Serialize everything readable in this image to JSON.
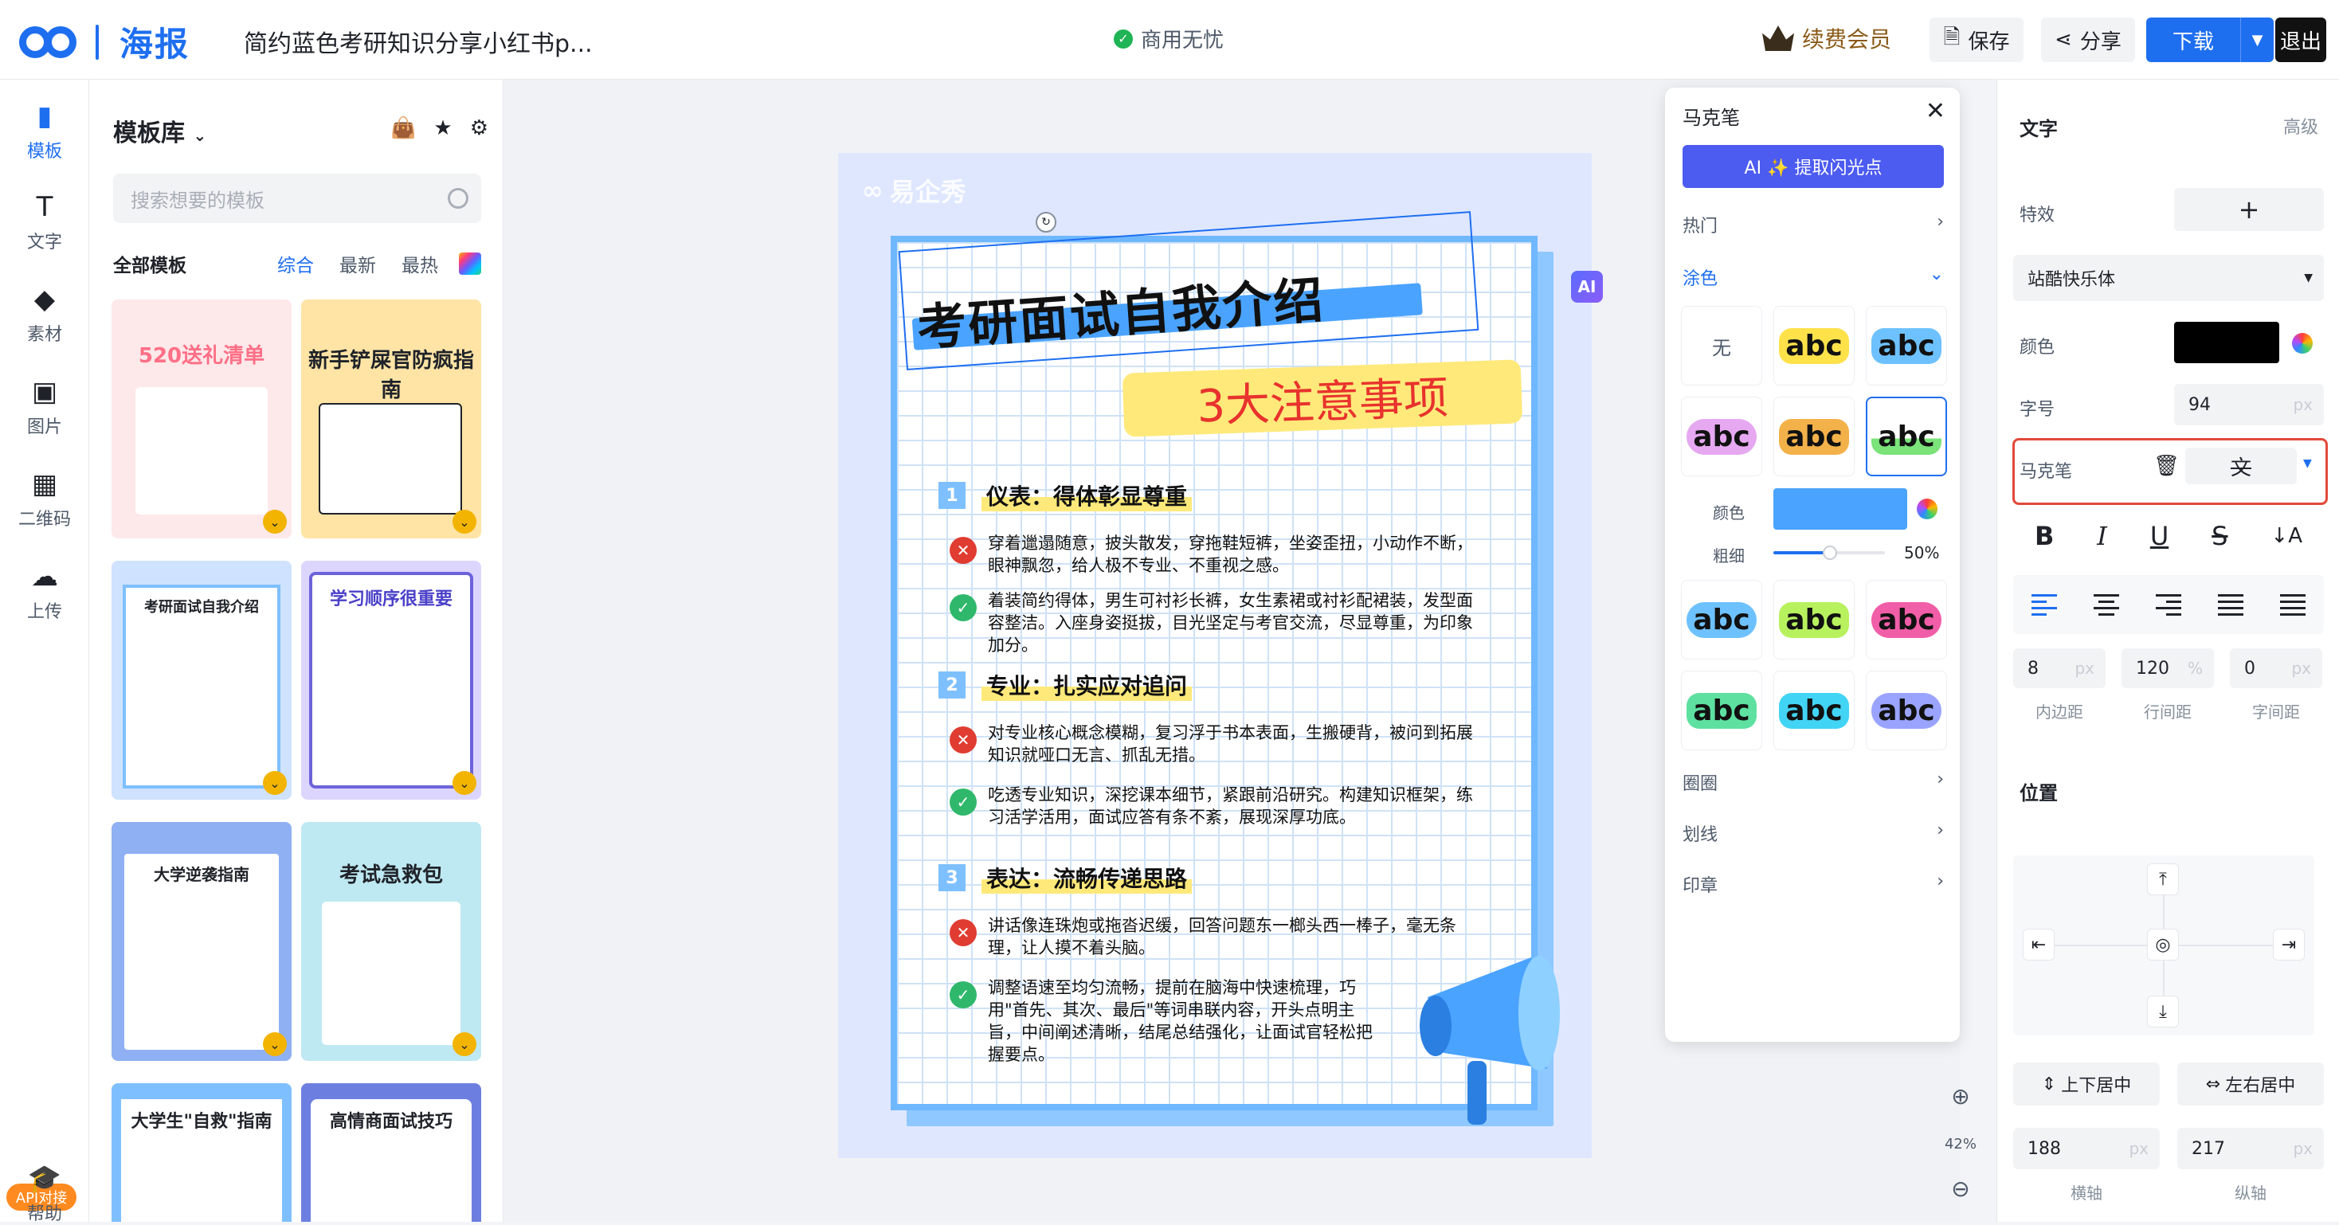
{
  "app": {
    "brand": "海报",
    "doc_title": "简约蓝色考研知识分享小红书p...",
    "commercial": "商用无忧",
    "vip": "续费会员",
    "save": "保存",
    "share": "分享",
    "download": "下载",
    "exit": "退出"
  },
  "leftbar": {
    "items": [
      {
        "label": "模板",
        "icon": "template-icon"
      },
      {
        "label": "文字",
        "icon": "text-icon"
      },
      {
        "label": "素材",
        "icon": "elements-icon"
      },
      {
        "label": "图片",
        "icon": "image-icon"
      },
      {
        "label": "二维码",
        "icon": "qrcode-icon"
      },
      {
        "label": "上传",
        "icon": "upload-icon"
      }
    ],
    "api_badge": "API对接",
    "help": "帮助"
  },
  "templates": {
    "header": "模板库",
    "search_placeholder": "搜索想要的模板",
    "all": "全部模板",
    "filters": [
      "综合",
      "最新",
      "最热"
    ],
    "cards": [
      {
        "title": "520送礼清单"
      },
      {
        "title": "新手铲屎官防疯指南"
      },
      {
        "title": "考研面试自我介绍"
      },
      {
        "title": "学习顺序很重要"
      },
      {
        "title": "大学逆袭指南"
      },
      {
        "title": "考试急救包"
      },
      {
        "title": "大学生\"自救\"指南"
      },
      {
        "title": "高情商面试技巧"
      }
    ]
  },
  "poster": {
    "logo": "易企秀",
    "title": "考研面试自我介绍",
    "subtitle": "3大注意事项",
    "ai": "AI",
    "sections": [
      {
        "num": "1",
        "label": "仪表：得体彰显尊重",
        "items": [
          {
            "type": "x",
            "text": "穿着邋遢随意，披头散发，穿拖鞋短裤，坐姿歪扭，小动作不断，眼神飘忽，给人极不专业、不重视之感。"
          },
          {
            "type": "v",
            "text": "着装简约得体，男生可衬衫长裤，女生素裙或衬衫配裙装，发型面容整洁。入座身姿挺拔，目光坚定与考官交流，尽显尊重，为印象加分。"
          }
        ]
      },
      {
        "num": "2",
        "label": "专业：扎实应对追问",
        "items": [
          {
            "type": "x",
            "text": "对专业核心概念模糊，复习浮于书本表面，生搬硬背，被问到拓展知识就哑口无言、抓乱无措。"
          },
          {
            "type": "v",
            "text": "吃透专业知识，深挖课本细节，紧跟前沿研究。构建知识框架，练习活学活用，面试应答有条不紊，展现深厚功底。"
          }
        ]
      },
      {
        "num": "3",
        "label": "表达：流畅传递思路",
        "items": [
          {
            "type": "x",
            "text": "讲话像连珠炮或拖沓迟缓，回答问题东一榔头西一棒子，毫无条理，让人摸不着头脑。"
          },
          {
            "type": "v",
            "text": "调整语速至均匀流畅，提前在脑海中快速梳理，巧用\"首先、其次、最后\"等词串联内容，开头点明主旨，中间阐述清晰，结尾总结强化，让面试官轻松把握要点。"
          }
        ]
      }
    ]
  },
  "marker_panel": {
    "title": "马克笔",
    "ai_button": "AI ✨ 提取闪光点",
    "hot": "热门",
    "fill": "涂色",
    "none": "无",
    "sample": "abc",
    "color_label": "颜色",
    "color_value": "#4AA3FF",
    "thickness_label": "粗细",
    "thickness": "50%",
    "circle": "圈圈",
    "line": "划线",
    "stamp": "印章",
    "swatch_colors": [
      "#ffe24a",
      "#6ec1ff",
      "#e6a8f0",
      "#f3b14a",
      "#7be37a",
      "#6ec1ff",
      "#b7f15e",
      "#f15ea8",
      "#5ee0a0",
      "#42d4f5",
      "#9aa4ff"
    ]
  },
  "right_panel": {
    "section_text": "文字",
    "advanced": "高级",
    "effect": "特效",
    "font": "站酷快乐体",
    "color_label": "颜色",
    "color_value": "#000000",
    "size_label": "字号",
    "size": "94",
    "marker_label": "马克笔",
    "padding": "8",
    "line_height": "120",
    "letter_spacing": "0",
    "padding_label": "内边距",
    "line_height_label": "行间距",
    "letter_spacing_label": "字间距",
    "unit_px": "px",
    "unit_pct": "%",
    "position": "位置",
    "v_center": "上下居中",
    "h_center": "左右居中",
    "x": "188",
    "y": "217",
    "x_label": "横轴",
    "y_label": "纵轴"
  },
  "zoom": {
    "level": "42%"
  }
}
